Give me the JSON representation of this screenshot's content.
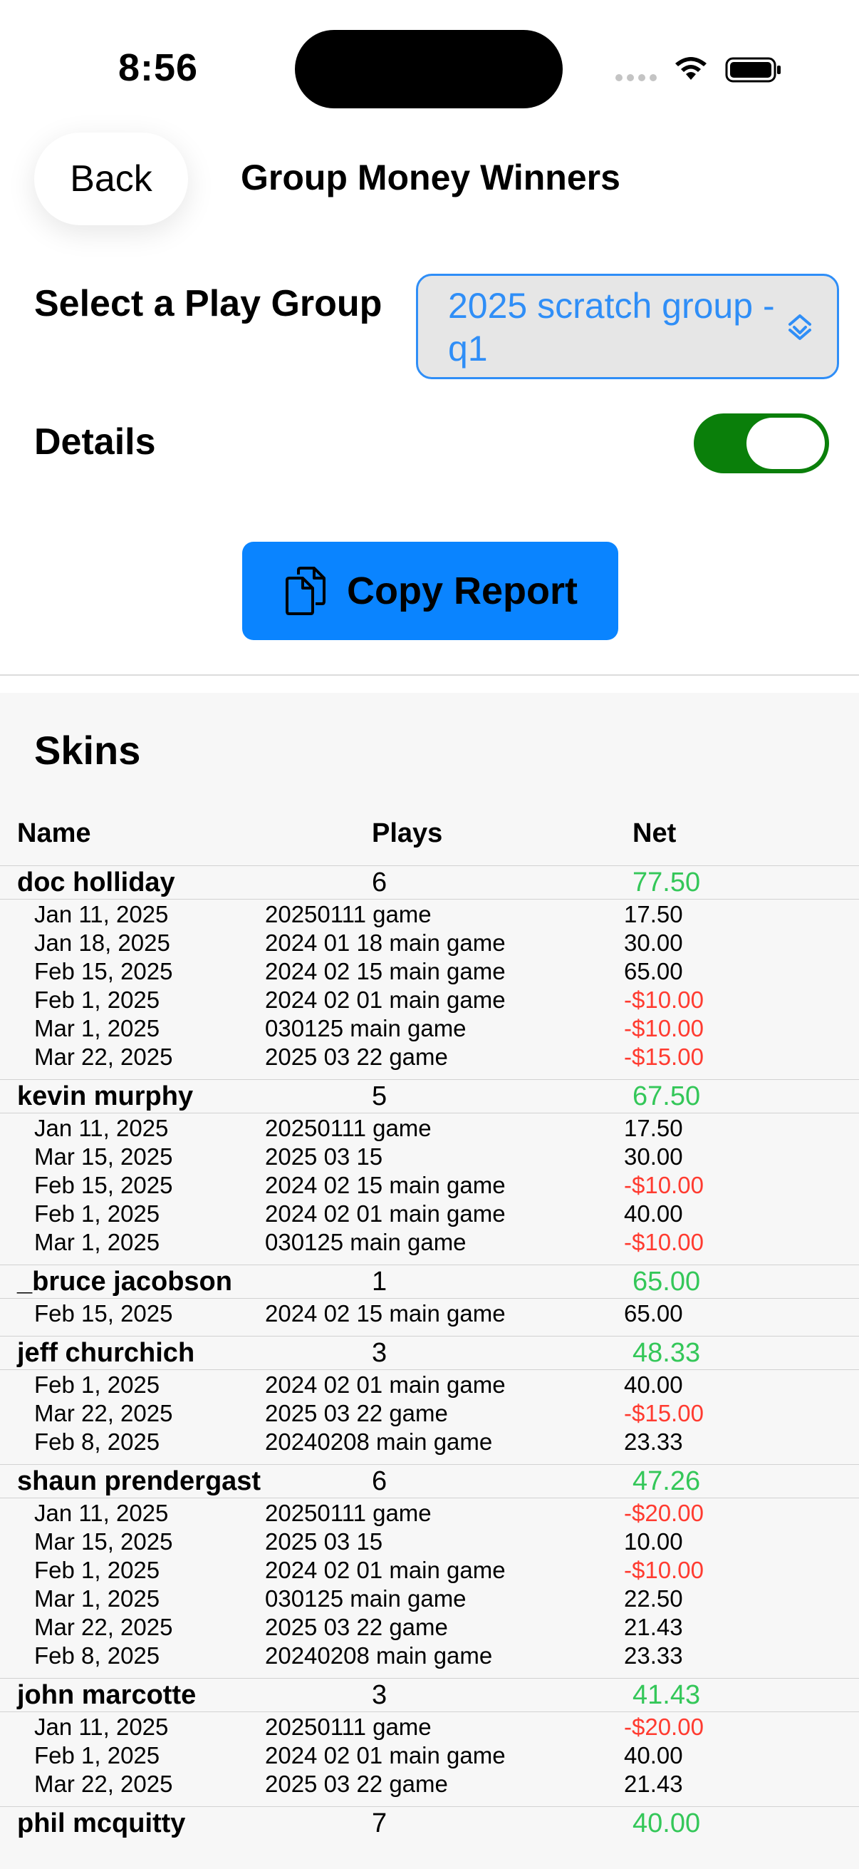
{
  "status": {
    "time": "8:56"
  },
  "nav": {
    "back_label": "Back",
    "title": "Group Money Winners"
  },
  "group_select": {
    "label": "Select a Play Group",
    "value": "2025 scratch group - q1"
  },
  "details": {
    "label": "Details",
    "enabled": true
  },
  "copy_button": {
    "label": "Copy Report"
  },
  "colors": {
    "accent": "#0a84ff",
    "positive": "#34c759",
    "negative": "#ff3b30",
    "toggle_on": "#0a7f0a"
  },
  "report": {
    "section_title": "Skins",
    "columns": {
      "name": "Name",
      "plays": "Plays",
      "net": "Net"
    },
    "players": [
      {
        "name": "doc holliday",
        "plays": "6",
        "net": "77.50",
        "games": [
          {
            "date": "Jan 11, 2025",
            "game": "20250111 game",
            "amount": "17.50"
          },
          {
            "date": "Jan 18, 2025",
            "game": "2024 01 18 main game",
            "amount": "30.00"
          },
          {
            "date": "Feb 15, 2025",
            "game": "2024 02 15 main game",
            "amount": "65.00"
          },
          {
            "date": "Feb 1, 2025",
            "game": "2024 02 01 main game",
            "amount": "-$10.00"
          },
          {
            "date": "Mar 1, 2025",
            "game": "030125 main game",
            "amount": "-$10.00"
          },
          {
            "date": "Mar 22, 2025",
            "game": "2025 03 22 game",
            "amount": "-$15.00"
          }
        ]
      },
      {
        "name": "kevin murphy",
        "plays": "5",
        "net": "67.50",
        "games": [
          {
            "date": "Jan 11, 2025",
            "game": "20250111 game",
            "amount": "17.50"
          },
          {
            "date": "Mar 15, 2025",
            "game": "2025 03 15",
            "amount": "30.00"
          },
          {
            "date": "Feb 15, 2025",
            "game": "2024 02 15 main game",
            "amount": "-$10.00"
          },
          {
            "date": "Feb 1, 2025",
            "game": "2024 02 01 main game",
            "amount": "40.00"
          },
          {
            "date": "Mar 1, 2025",
            "game": "030125 main game",
            "amount": "-$10.00"
          }
        ]
      },
      {
        "name": "_bruce jacobson",
        "plays": "1",
        "net": "65.00",
        "games": [
          {
            "date": "Feb 15, 2025",
            "game": "2024 02 15 main game",
            "amount": "65.00"
          }
        ]
      },
      {
        "name": "jeff churchich",
        "plays": "3",
        "net": "48.33",
        "games": [
          {
            "date": "Feb 1, 2025",
            "game": "2024 02 01 main game",
            "amount": "40.00"
          },
          {
            "date": "Mar 22, 2025",
            "game": "2025 03 22 game",
            "amount": "-$15.00"
          },
          {
            "date": "Feb 8, 2025",
            "game": "20240208 main game",
            "amount": "23.33"
          }
        ]
      },
      {
        "name": "shaun prendergast",
        "plays": "6",
        "net": "47.26",
        "games": [
          {
            "date": "Jan 11, 2025",
            "game": "20250111 game",
            "amount": "-$20.00"
          },
          {
            "date": "Mar 15, 2025",
            "game": "2025 03 15",
            "amount": "10.00"
          },
          {
            "date": "Feb 1, 2025",
            "game": "2024 02 01 main game",
            "amount": "-$10.00"
          },
          {
            "date": "Mar 1, 2025",
            "game": "030125 main game",
            "amount": "22.50"
          },
          {
            "date": "Mar 22, 2025",
            "game": "2025 03 22 game",
            "amount": "21.43"
          },
          {
            "date": "Feb 8, 2025",
            "game": "20240208 main game",
            "amount": "23.33"
          }
        ]
      },
      {
        "name": "john marcotte",
        "plays": "3",
        "net": "41.43",
        "games": [
          {
            "date": "Jan 11, 2025",
            "game": "20250111 game",
            "amount": "-$20.00"
          },
          {
            "date": "Feb 1, 2025",
            "game": "2024 02 01 main game",
            "amount": "40.00"
          },
          {
            "date": "Mar 22, 2025",
            "game": "2025 03 22 game",
            "amount": "21.43"
          }
        ]
      },
      {
        "name": "phil mcquitty",
        "plays": "7",
        "net": "40.00",
        "games": []
      }
    ]
  }
}
